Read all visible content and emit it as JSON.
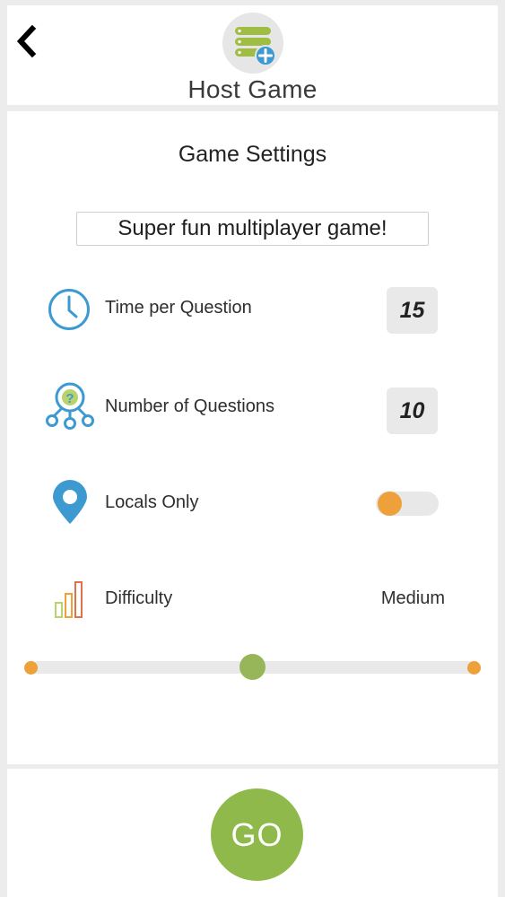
{
  "header": {
    "title": "Host Game",
    "back_icon": "chevron-left-icon",
    "host_icon": "server-add-icon"
  },
  "settings": {
    "title": "Game Settings",
    "game_name": "Super fun multiplayer game!",
    "time_per_question": {
      "label": "Time per Question",
      "value": "15",
      "icon": "clock-icon"
    },
    "number_of_questions": {
      "label": "Number of Questions",
      "value": "10",
      "icon": "question-network-icon"
    },
    "locals_only": {
      "label": "Locals Only",
      "enabled": false,
      "icon": "location-pin-icon"
    },
    "difficulty": {
      "label": "Difficulty",
      "value": "Medium",
      "icon": "signal-bars-icon",
      "level": 0.5
    }
  },
  "footer": {
    "go_label": "GO"
  },
  "colors": {
    "accent_orange": "#eea03a",
    "accent_green": "#8fba4b",
    "accent_blue": "#3d9ad1",
    "background": "#ececec"
  }
}
